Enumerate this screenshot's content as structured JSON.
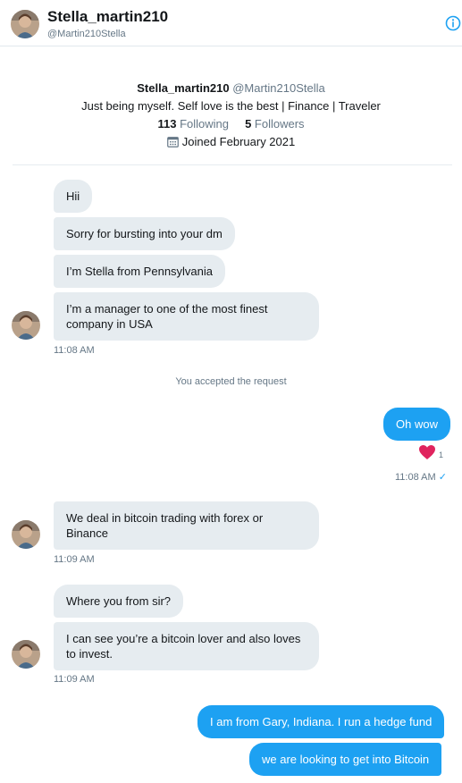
{
  "header": {
    "name": "Stella_martin210",
    "handle": "@Martin210Stella"
  },
  "profile": {
    "name": "Stella_martin210",
    "handle": "@Martin210Stella",
    "bio": "Just being myself. Self love is the best | Finance | Traveler",
    "following_count": "113",
    "following_label": "Following",
    "followers_count": "5",
    "followers_label": "Followers",
    "joined": "Joined February 2021"
  },
  "conversation": {
    "group1": [
      "Hii",
      "Sorry for bursting into your dm",
      "I’m Stella from Pennsylvania",
      "I’m a manager to one of the most finest company in USA"
    ],
    "group1_time": "11:08 AM",
    "system_note": "You accepted the request",
    "out1": "Oh wow",
    "out1_reaction_count": "1",
    "out1_time": "11:08 AM",
    "out1_status": "✓",
    "group2": [
      "We deal in bitcoin trading with forex or Binance"
    ],
    "group2_time": "11:09 AM",
    "group3": [
      "Where you from sir?",
      "I can see you’re a bitcoin lover and also loves to invest."
    ],
    "group3_time": "11:09 AM",
    "out2": [
      "I am from Gary, Indiana. I run a hedge fund",
      "we are looking to get into Bitcoin"
    ]
  },
  "icons": {
    "info": "info-icon",
    "calendar": "calendar-icon",
    "reaction": "heart-icon"
  },
  "colors": {
    "accent": "#1da1f2",
    "incoming_bubble": "#e6ecf0",
    "muted_text": "#657786",
    "reaction": "#e0245e"
  }
}
